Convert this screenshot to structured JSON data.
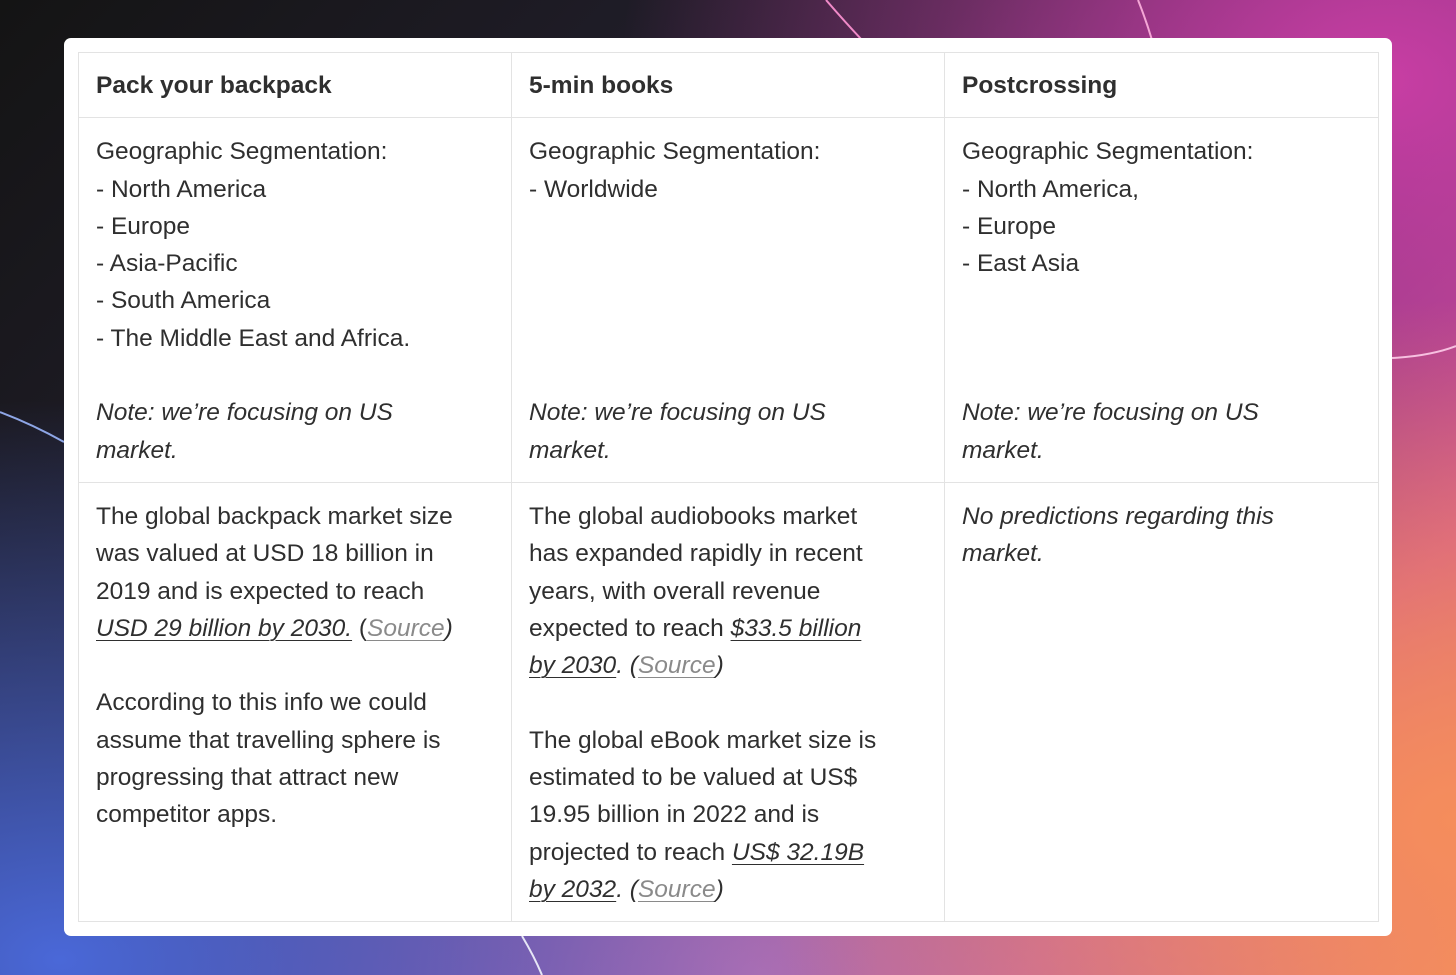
{
  "table": {
    "headers": [
      "Pack your backpack",
      "5-min books",
      "Postcrossing"
    ],
    "geo": [
      {
        "lines": [
          "Geographic Segmentation:",
          "- North America",
          "- Europe",
          "- Asia-Pacific",
          "- South America",
          "- The Middle East and Africa."
        ],
        "note": [
          "Note: we’re focusing on US",
          "market."
        ]
      },
      {
        "lines": [
          "Geographic Segmentation:",
          "- Worldwide"
        ],
        "note": [
          "Note: we’re focusing on US",
          "market."
        ]
      },
      {
        "lines": [
          "Geographic Segmentation:",
          "- North America,",
          "- Europe",
          "- East Asia"
        ],
        "note": [
          "Note: we’re focusing on US",
          "market."
        ]
      }
    ],
    "market": {
      "col1": {
        "l1": "The global backpack market size",
        "l2": "was valued at USD 18 billion in",
        "l3": "2019 and is expected to reach",
        "link": "USD 29 billion by 2030.",
        "paren_open": " (",
        "source": "Source",
        "paren_close": ")",
        "p2": [
          "According to this info we could",
          "assume that travelling sphere is",
          "progressing that attract new",
          "competitor apps."
        ]
      },
      "col2": {
        "l1": "The global audiobooks market",
        "l2": "has expanded rapidly in recent",
        "l3": "years, with overall revenue",
        "l4_text": "expected to reach ",
        "link_a": "$33.5 billion",
        "link_b": "by 2030",
        "tail": ". (",
        "source": "Source",
        "paren_close": ")",
        "p2_l1": "The global eBook market size is",
        "p2_l2": "estimated to be valued at US$",
        "p2_l3": "19.95 billion in 2022 and is",
        "p2_l4_text": "projected to reach ",
        "link2_a": "US$ 32.19B",
        "link2_b": "by 2032",
        "tail2": ". (",
        "source2": "Source",
        "paren_close2": ")"
      },
      "col3": [
        "No predictions regarding this",
        "market."
      ]
    }
  },
  "colors": {
    "text": "#2f2f2f",
    "border": "#e3e3e3",
    "source_link": "#8a8a8a",
    "card": "#ffffff"
  }
}
